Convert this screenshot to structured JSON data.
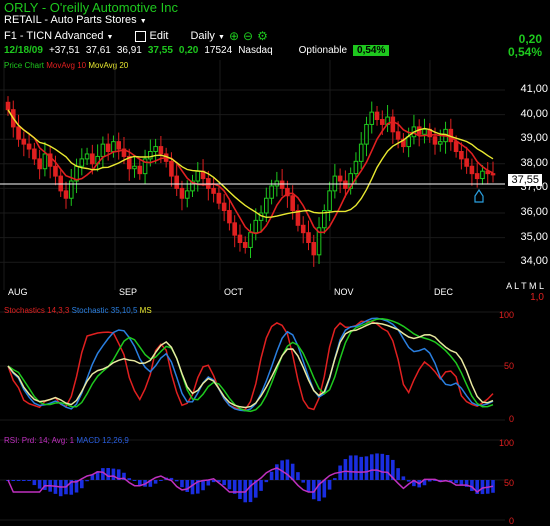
{
  "header": {
    "symbol": "ORLY",
    "company": "O'reilly Automotive Inc",
    "industry": "RETAIL - Auto Parts Stores",
    "layout_name": "F1 - TICN Advanced",
    "edit_label": "Edit",
    "period": "Daily"
  },
  "quote": {
    "date": "12/18/09",
    "open": "+37,51",
    "high": "37,61",
    "low": "36,91",
    "close": "37,55",
    "change": "0,20",
    "volume": "17524",
    "exchange": "Nasdaq",
    "optionable": "Optionable",
    "pct_change": "0,54%",
    "right_change": "0,20",
    "right_pct": "0,54%"
  },
  "price_pane": {
    "legend_a": "Price Chart",
    "legend_b": "MovAvg 10",
    "legend_c": "MovAvg 20",
    "levels": [
      "41,00",
      "40,00",
      "39,00",
      "38,00",
      "37,00",
      "36,00",
      "35,00",
      "34,00"
    ],
    "last_price": "37,55",
    "months": [
      "AUG",
      "SEP",
      "OCT",
      "NOV",
      "DEC"
    ],
    "side_text": "A L T M L",
    "side_value": "1,0"
  },
  "stoch_pane": {
    "legend_a": "Stochastics 14,3,3",
    "legend_b": "Stochastic 35,10,5",
    "legend_c": "MS",
    "levels": [
      "100",
      "50",
      "0"
    ]
  },
  "rsi_pane": {
    "legend_a": "RSI: Prd: 14; Avg: 1",
    "legend_b": "MACD 12,26,9",
    "levels": [
      "100",
      "50",
      "0"
    ]
  },
  "colors": {
    "up": "#1ec81e",
    "down": "#e02020",
    "ma10": "#e02020",
    "ma20": "#e8e830",
    "stoch1": "#e02020",
    "stoch2": "#2a7fe0",
    "stoch3": "#1ec81e",
    "ms": "#e8e8a0",
    "rsi": "#c030c0",
    "macd": "#1a2ee0"
  }
}
